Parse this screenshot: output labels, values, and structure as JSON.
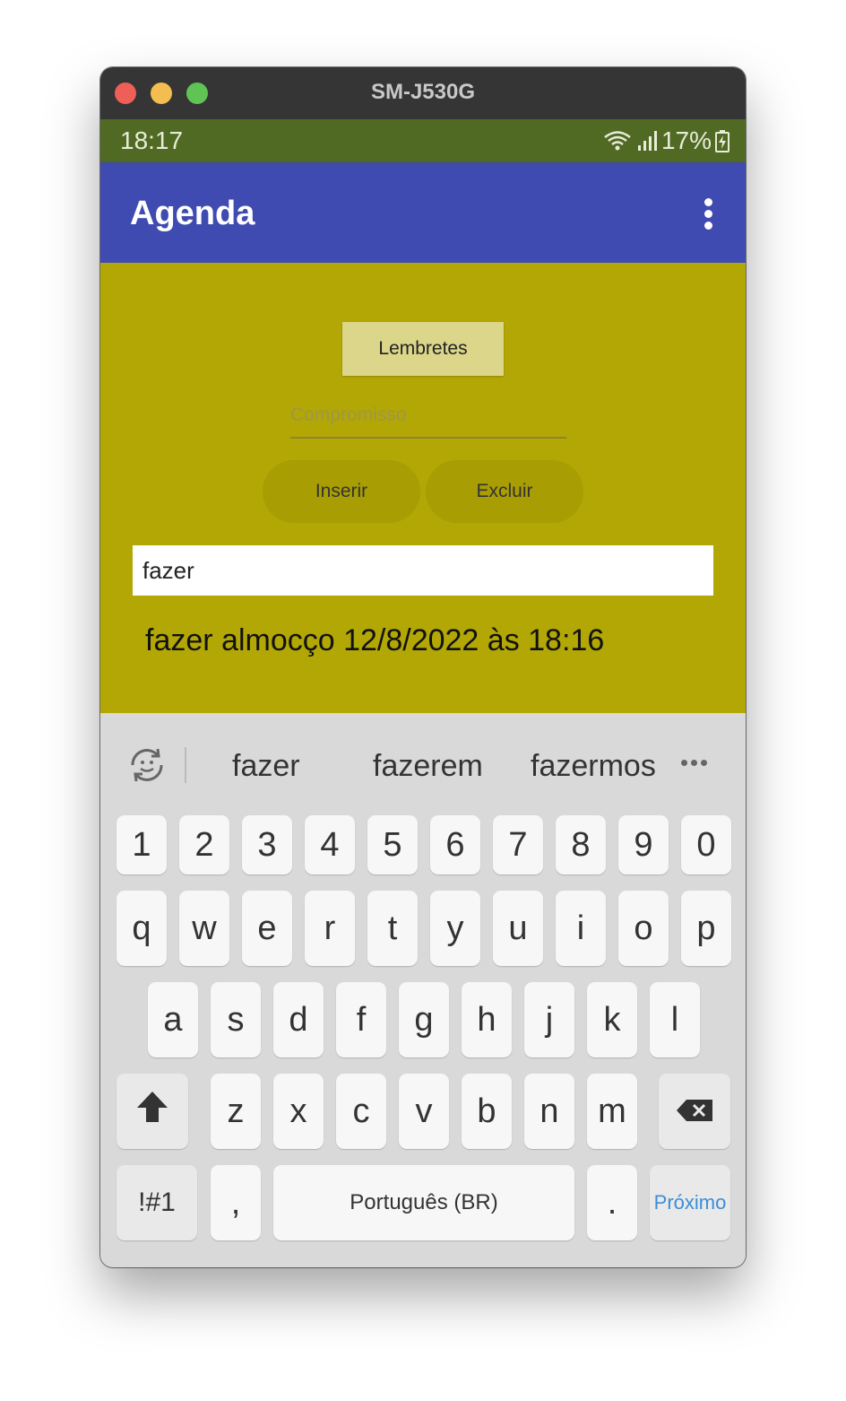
{
  "window": {
    "title": "SM-J530G"
  },
  "status_bar": {
    "time": "18:17",
    "battery": "17%"
  },
  "app_bar": {
    "title": "Agenda"
  },
  "main": {
    "lembretes_label": "Lembretes",
    "compromisso_placeholder": "Compromisso",
    "inserir_label": "Inserir",
    "excluir_label": "Excluir",
    "search_value": "fazer",
    "result_text": "fazer almocço 12/8/2022 às 18:16"
  },
  "keyboard": {
    "suggestions": [
      "fazer",
      "fazerem",
      "fazermos"
    ],
    "row_numbers": [
      "1",
      "2",
      "3",
      "4",
      "5",
      "6",
      "7",
      "8",
      "9",
      "0"
    ],
    "row_1": [
      "q",
      "w",
      "e",
      "r",
      "t",
      "y",
      "u",
      "i",
      "o",
      "p"
    ],
    "row_2": [
      "a",
      "s",
      "d",
      "f",
      "g",
      "h",
      "j",
      "k",
      "l"
    ],
    "row_3": [
      "z",
      "x",
      "c",
      "v",
      "b",
      "n",
      "m"
    ],
    "symbols_label": "!#1",
    "comma_label": ",",
    "space_label": "Português (BR)",
    "period_label": ".",
    "next_label": "Próximo"
  },
  "colors": {
    "status_bar": "#506a24",
    "app_bar": "#3f4bb0",
    "content_bg": "#b2a704",
    "lembretes_button": "#dbd68a",
    "next_key_text": "#3d8dd6"
  }
}
